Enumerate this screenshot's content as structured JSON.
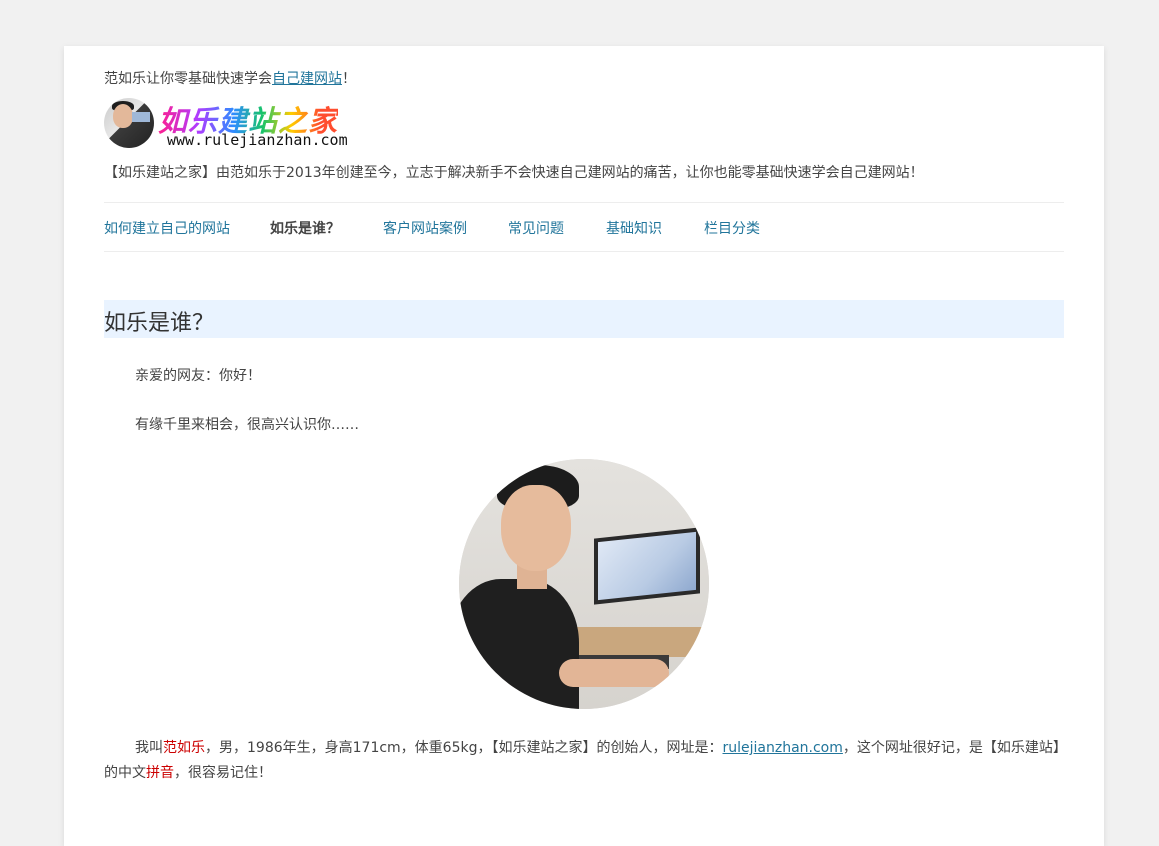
{
  "header": {
    "tagline_prefix": "范如乐让你零基础快速学会",
    "tagline_link": "自己建网站",
    "tagline_suffix": "！",
    "logo_text": "如乐建站之家",
    "logo_url": "www.rulejianzhan.com",
    "description": "【如乐建站之家】由范如乐于2013年创建至今，立志于解决新手不会快速自己建网站的痛苦，让你也能零基础快速学会自己建网站！"
  },
  "nav": {
    "items": [
      {
        "label": "如何建立自己的网站"
      },
      {
        "label": "如乐是谁？"
      },
      {
        "label": "客户网站案例"
      },
      {
        "label": "常见问题"
      },
      {
        "label": "基础知识"
      },
      {
        "label": "栏目分类"
      }
    ]
  },
  "article": {
    "title": "如乐是谁？",
    "greeting": "亲爱的网友：你好！",
    "line2": "有缘千里来相会，很高兴认识你……",
    "intro": {
      "t1": "我叫",
      "name": "范如乐",
      "t2": "，男，1986年生，身高171cm，体重65kg，【如乐建站之家】的创始人，网址是：",
      "link": "rulejianzhan.com",
      "t3": "，这个网址很好记，是【如乐建站】的中文",
      "pinyin": "拼音",
      "t4": "，很容易记住！"
    }
  },
  "colors": {
    "link": "#21759b",
    "highlight": "#c00000",
    "title_bar": "#e9f3ff",
    "background": "#f1f1f1"
  }
}
